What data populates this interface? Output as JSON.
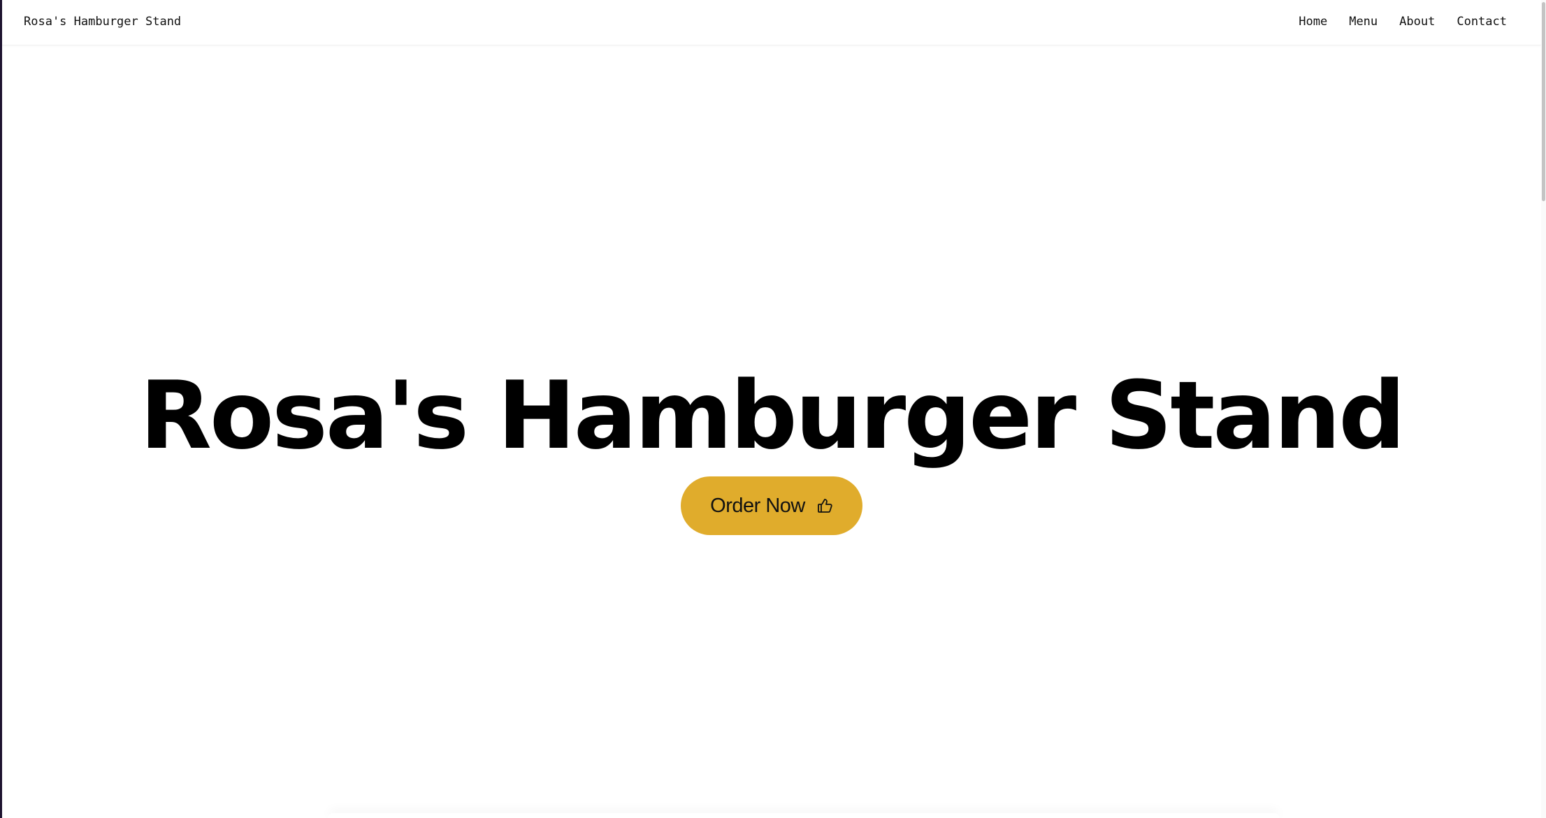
{
  "navbar": {
    "brand": "Rosa's Hamburger Stand",
    "links": [
      {
        "label": "Home"
      },
      {
        "label": "Menu"
      },
      {
        "label": "About"
      },
      {
        "label": "Contact"
      }
    ]
  },
  "hero": {
    "title": "Rosa's Hamburger Stand",
    "cta": {
      "label": "Order Now",
      "icon": "thumbs-up-icon"
    }
  },
  "colors": {
    "cta_background": "#e0ac2c",
    "text": "#000000",
    "background": "#ffffff"
  }
}
